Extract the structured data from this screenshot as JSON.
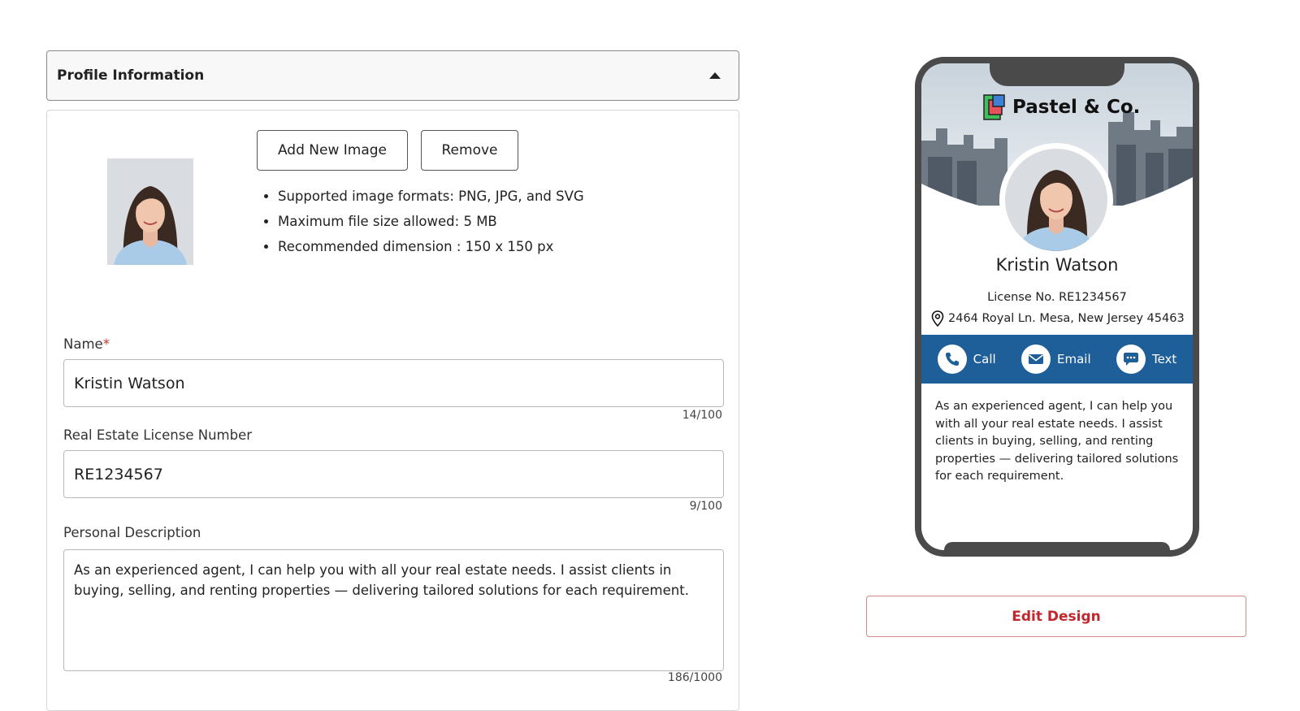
{
  "accordion": {
    "title": "Profile Information",
    "icon": "caret-up-icon"
  },
  "image_section": {
    "add_button": "Add New Image",
    "remove_button": "Remove",
    "requirements": [
      "Supported image formats: PNG, JPG, and SVG",
      "Maximum file size allowed: 5 MB",
      "Recommended dimension : 150 x 150 px"
    ]
  },
  "form": {
    "name": {
      "label": "Name",
      "required_mark": "*",
      "value": "Kristin Watson",
      "counter": "14/100"
    },
    "license": {
      "label": "Real Estate License Number",
      "value": "RE1234567",
      "counter": "9/100"
    },
    "description": {
      "label": "Personal Description",
      "value": "As an experienced agent, I can help you with all your real estate needs. I assist clients in buying, selling, and renting properties — delivering tailored solutions for each requirement.",
      "counter": "186/1000"
    }
  },
  "preview": {
    "brand": "Pastel & Co.",
    "name": "Kristin Watson",
    "license": "License No. RE1234567",
    "address": "2464 Royal Ln. Mesa, New Jersey 45463",
    "actions": {
      "call": "Call",
      "email": "Email",
      "text": "Text"
    },
    "description": "As an experienced agent, I can help you with all your real estate needs. I assist clients in buying, selling, and renting properties — delivering tailored solutions for each requirement.",
    "accent_color": "#1e5f99"
  },
  "edit_design_button": "Edit Design"
}
